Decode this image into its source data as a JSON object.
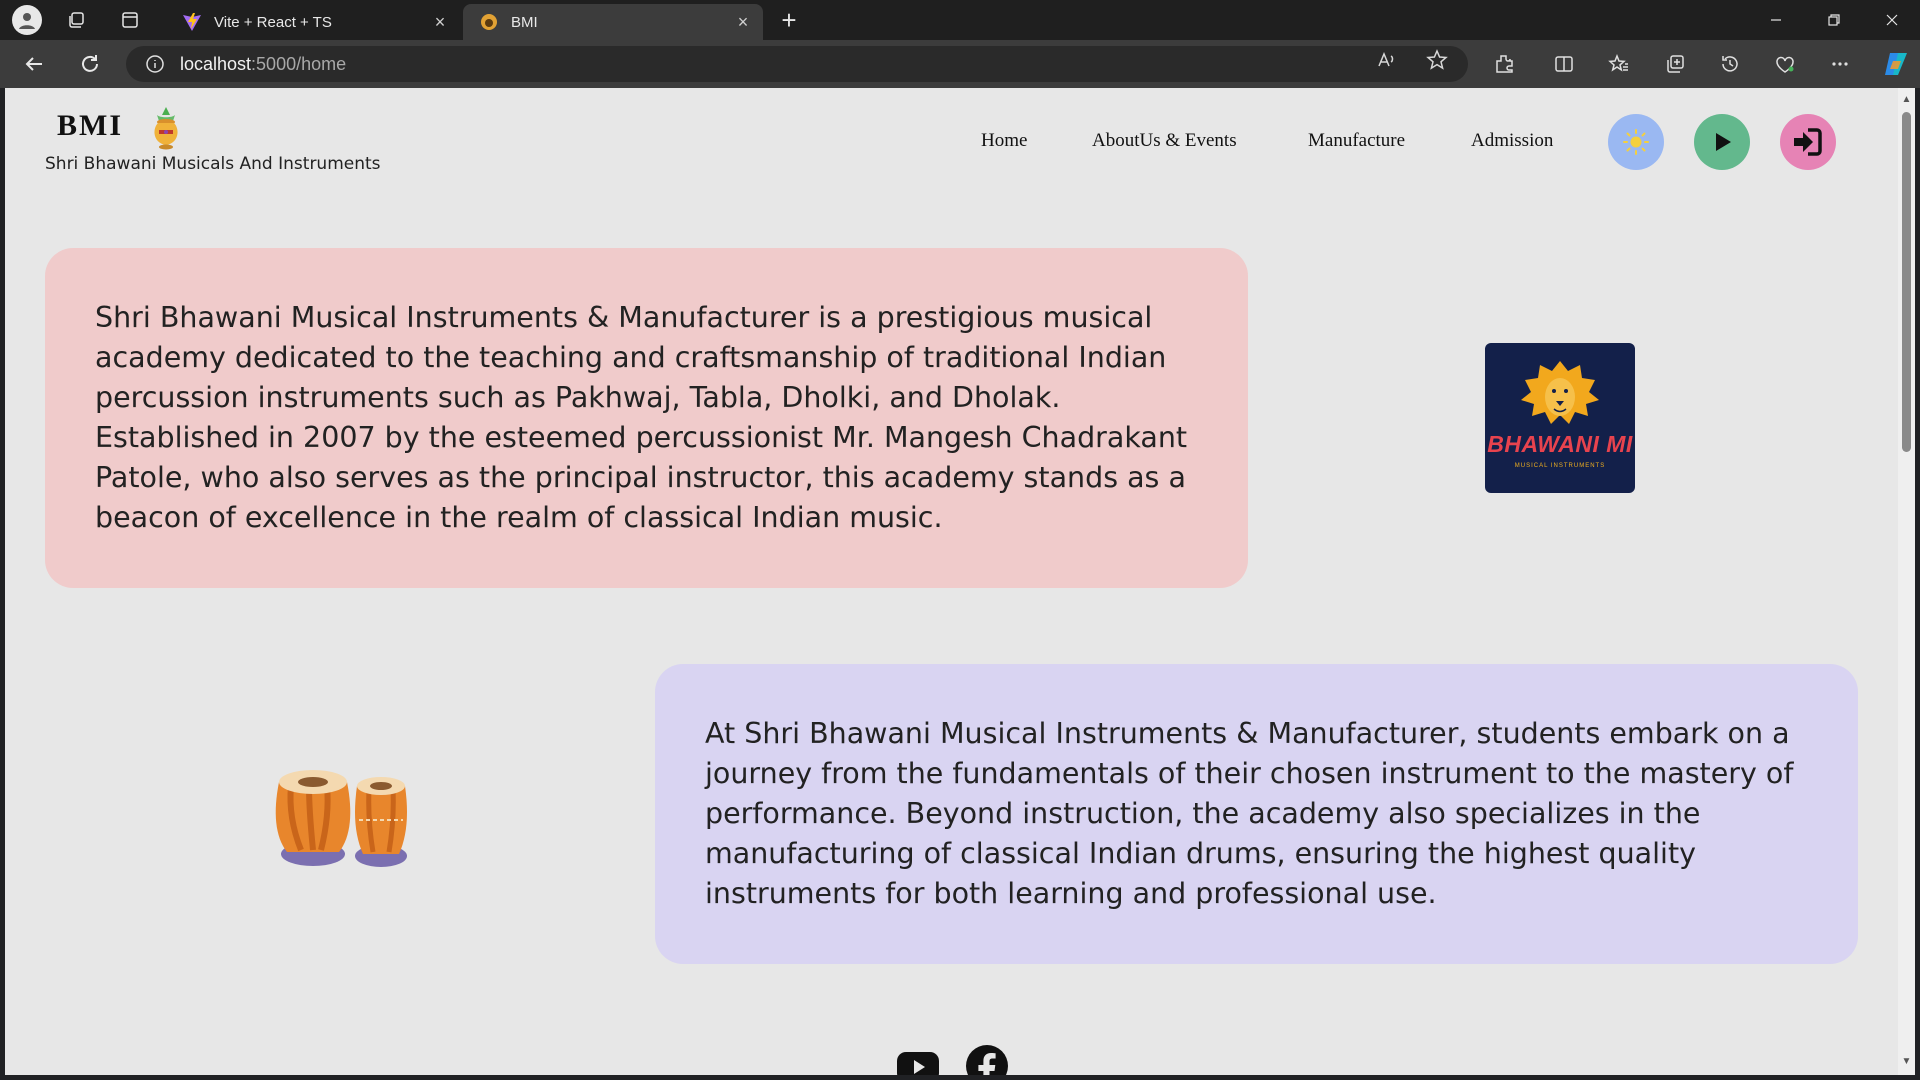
{
  "browser": {
    "tabs": [
      {
        "title": "Vite + React + TS",
        "active": false
      },
      {
        "title": "BMI",
        "active": true
      }
    ],
    "address": {
      "host": "localhost",
      "path": ":5000/home"
    }
  },
  "header": {
    "brand": "BMI",
    "tagline": "Shri Bhawani Musicals And Instruments",
    "nav": [
      "Home",
      "AboutUs & Events",
      "Manufacture",
      "Admission"
    ]
  },
  "sections": [
    {
      "text": "Shri Bhawani Musical Instruments & Manufacturer is a prestigious musical academy dedicated to the teaching and craftsmanship of traditional Indian percussion instruments such as Pakhwaj, Tabla, Dholki, and Dholak. Established in 2007 by the esteemed percussionist Mr. Mangesh Chadrakant Patole, who also serves as the principal instructor, this academy stands as a beacon of excellence in the realm of classical Indian music.",
      "color": "#f0cbcb"
    },
    {
      "text": "At Shri Bhawani Musical Instruments & Manufacturer, students embark on a journey from the fundamentals of their chosen instrument to the mastery of performance. Beyond instruction, the academy also specializes in the manufacturing of classical Indian drums, ensuring the highest quality instruments for both learning and professional use.",
      "color": "#d9d4f2"
    }
  ],
  "logo": {
    "title": "BHAWANI MI",
    "subtitle": "MUSICAL INSTRUMENTS"
  },
  "icons": {
    "theme_toggle": "sun-icon",
    "play": "play-icon",
    "login": "login-icon",
    "social": [
      "youtube-icon",
      "facebook-icon"
    ]
  },
  "colors": {
    "page_bg": "#e7e7e7",
    "theme_button": "#9ab8f2",
    "play_button": "#63b88d",
    "login_button": "#e683b5"
  }
}
